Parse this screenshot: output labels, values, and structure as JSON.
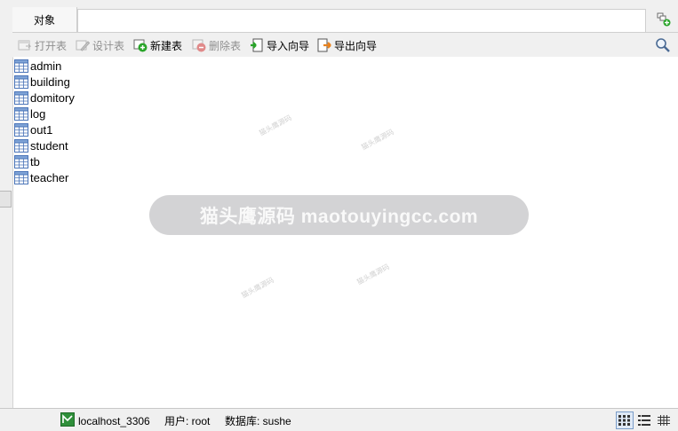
{
  "tabs": {
    "objects_label": "对象"
  },
  "toolbar": {
    "open_table": "打开表",
    "design_table": "设计表",
    "new_table": "新建表",
    "delete_table": "删除表",
    "import_wizard": "导入向导",
    "export_wizard": "导出向导"
  },
  "tables": [
    "admin",
    "building",
    "domitory",
    "log",
    "out1",
    "student",
    "tb",
    "teacher"
  ],
  "watermark": {
    "main": "猫头鹰源码 maotouyingcc.com",
    "small": "猫头鹰源码"
  },
  "status": {
    "connection": "localhost_3306",
    "user": "用户: root",
    "database": "数据库: sushe"
  },
  "icons": {
    "new_tab": "new-object-tab-icon",
    "search": "search-icon",
    "table": "table-grid-icon",
    "view_modes": [
      "grid-view-icon",
      "list-view-icon",
      "detail-view-icon"
    ]
  },
  "colors": {
    "accent_green": "#2aa52a",
    "accent_orange": "#e8821e",
    "table_icon_blue": "#4a74b8"
  }
}
